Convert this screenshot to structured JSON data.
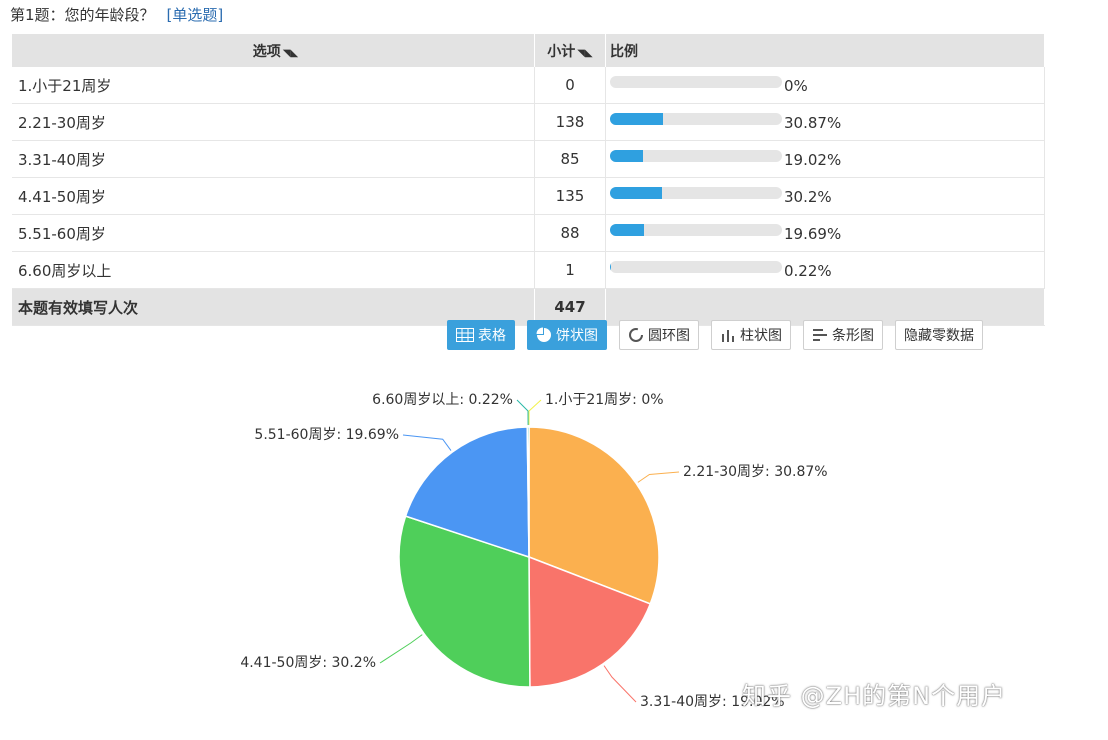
{
  "question": {
    "title": "第1题：您的年龄段？",
    "type": "[单选题]"
  },
  "table": {
    "headers": {
      "option": "选项",
      "count": "小计",
      "ratio": "比例"
    },
    "rows": [
      {
        "label": "1.小于21周岁",
        "count": "0",
        "pct": "0%",
        "fraction": 0.0
      },
      {
        "label": "2.21-30周岁",
        "count": "138",
        "pct": "30.87%",
        "fraction": 0.3087
      },
      {
        "label": "3.31-40周岁",
        "count": "85",
        "pct": "19.02%",
        "fraction": 0.1902
      },
      {
        "label": "4.41-50周岁",
        "count": "135",
        "pct": "30.2%",
        "fraction": 0.302
      },
      {
        "label": "5.51-60周岁",
        "count": "88",
        "pct": "19.69%",
        "fraction": 0.1969
      },
      {
        "label": "6.60周岁以上",
        "count": "1",
        "pct": "0.22%",
        "fraction": 0.0022
      }
    ],
    "total": {
      "label": "本题有效填写人次",
      "count": "447"
    }
  },
  "buttons": {
    "table": "表格",
    "pie": "饼状图",
    "ring": "圆环图",
    "column": "柱状图",
    "bar": "条形图",
    "hide_zero": "隐藏零数据"
  },
  "chart_data": {
    "type": "pie",
    "labels": [
      "1.小于21周岁",
      "2.21-30周岁",
      "3.31-40周岁",
      "4.41-50周岁",
      "5.51-60周岁",
      "6.60周岁以上"
    ],
    "values": [
      0,
      30.87,
      19.02,
      30.2,
      19.69,
      0.22
    ],
    "label_texts": [
      "1.小于21周岁: 0%",
      "2.21-30周岁: 30.87%",
      "3.31-40周岁: 19.02%",
      "4.41-50周岁: 30.2%",
      "5.51-60周岁: 19.69%",
      "6.60周岁以上: 0.22%"
    ],
    "colors": [
      "#f2f24a",
      "#fbb04f",
      "#f9746a",
      "#4fcf5a",
      "#4b96f3",
      "#2ab9a8"
    ]
  },
  "watermark": "知乎 @ZH的第N个用户"
}
